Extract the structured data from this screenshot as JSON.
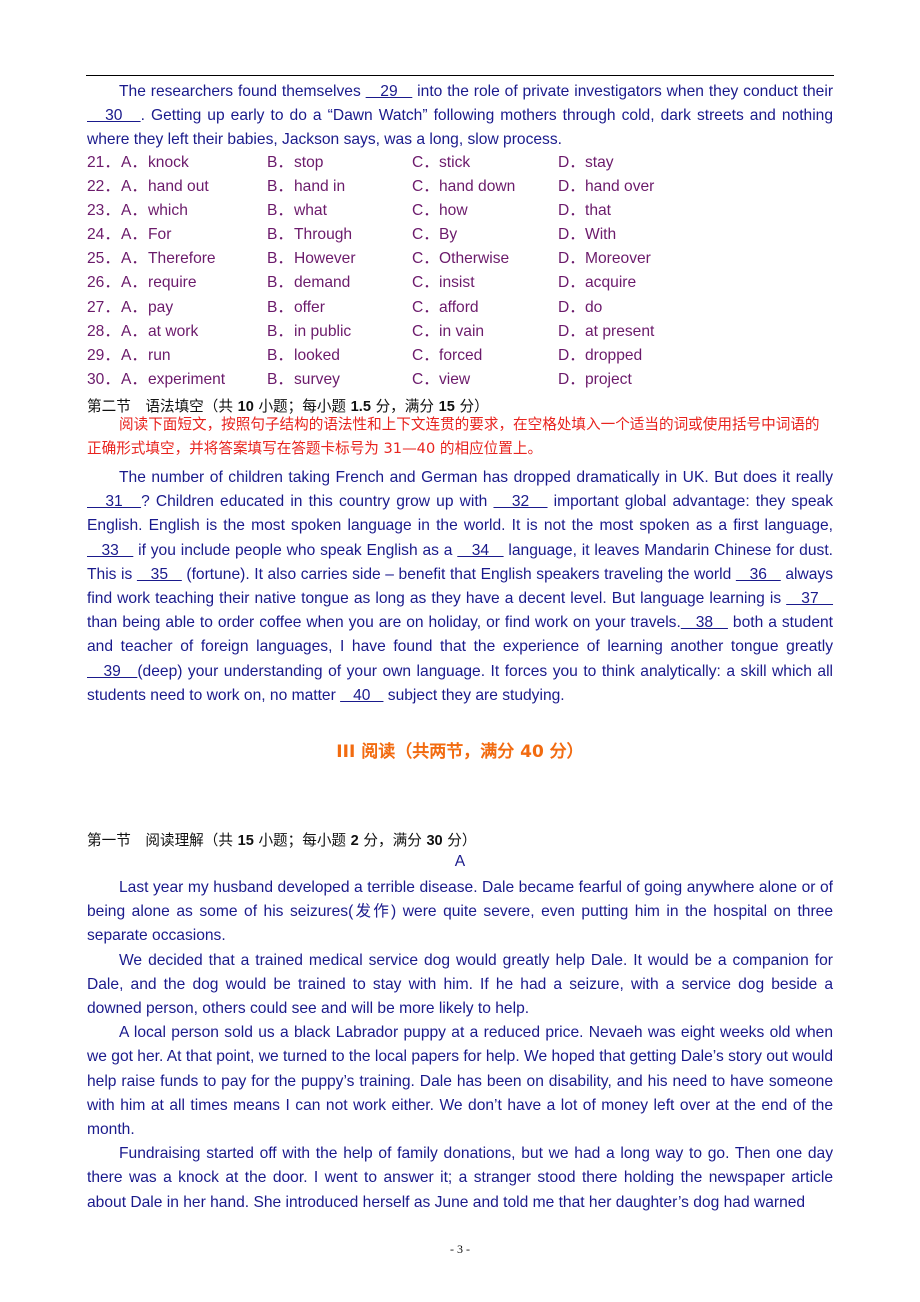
{
  "cloze_tail": {
    "line1_pre": "The researchers found themselves ",
    "blank29": "   29   ",
    "line1_post": " into the role of private investigators when they conduct their ",
    "blank30": "   30   ",
    "line2_post": ". Getting up early to do a “Dawn Watch” following mothers through cold, dark streets and nothing where they left their babies, Jackson says, was a long, slow process."
  },
  "options": [
    {
      "num": "21．",
      "A": "knock",
      "B": "stop",
      "C": "stick",
      "D": "stay"
    },
    {
      "num": "22．",
      "A": "hand out",
      "B": "hand in",
      "C": "hand down",
      "D": "hand over"
    },
    {
      "num": "23．",
      "A": "which",
      "B": "what",
      "C": "how",
      "D": "that"
    },
    {
      "num": "24．",
      "A": "For",
      "B": "Through",
      "C": "By",
      "D": "With"
    },
    {
      "num": "25．",
      "A": "Therefore",
      "B": "However",
      "C": "Otherwise",
      "D": "Moreover"
    },
    {
      "num": "26．",
      "A": "require",
      "B": "demand",
      "C": "insist",
      "D": "acquire"
    },
    {
      "num": "27．",
      "A": "pay",
      "B": "offer",
      "C": "afford",
      "D": "do"
    },
    {
      "num": "28．",
      "A": "at work",
      "B": "in public",
      "C": "in vain",
      "D": "at present"
    },
    {
      "num": "29．",
      "A": "run",
      "B": "looked",
      "C": "forced",
      "D": "dropped"
    },
    {
      "num": "30．",
      "A": "experiment",
      "B": "survey",
      "C": "view",
      "D": "project"
    }
  ],
  "option_labels": {
    "A": "A．",
    "B": "B．",
    "C": "C．",
    "D": "D．"
  },
  "section2": {
    "heading_prefix": "第二节　语法填空（共 ",
    "count": "10",
    "heading_mid1": " 小题；每小题 ",
    "per": "1.5",
    "heading_mid2": " 分，满分 ",
    "total": "15",
    "heading_suffix": " 分）",
    "instructions": "阅读下面短文，按照句子结构的语法性和上下文连贯的要求，在空格处填入一个适当的词或使用括号中词语的正确形式填空，并将答案填写在答题卡标号为 31—40 的相应位置上。"
  },
  "grammar_passage": {
    "s1": "The number of children taking French and German has dropped dramatically in UK. But does it really ",
    "b31": "   31   ",
    "s2": "? Children educated in this country grow up with ",
    "b32": "   32   ",
    "s3": " important global advantage: they speak English. English is the most spoken language in the world. It is not the most spoken as a first language,",
    "b33": "   33   ",
    "s4": " if you include people who speak English as a ",
    "b34": "   34   ",
    "s5": " language, it leaves Mandarin Chinese for dust. This is ",
    "b35": "   35   ",
    "s6": " (fortune). It also carries side – benefit that English speakers traveling the world ",
    "b36": "   36   ",
    "s7": " always find work teaching their native tongue as long as they have a decent level. But language learning is ",
    "b37": "   37   ",
    "s8": " than being able to order coffee when you are on holiday, or find work on your travels.",
    "b38": "   38   ",
    "s9": " both a student and teacher of foreign languages, I have found that the experience of learning another tongue greatly",
    "b39": "   39   ",
    "s10": "(deep) your understanding of your own language. It forces you to think analytically: a skill which all students need to work on, no matter ",
    "b40": "   40   ",
    "s11": " subject they are studying."
  },
  "part3_title": "III  阅读（共两节，满分 40 分）",
  "section1": {
    "heading_prefix": "第一节　阅读理解（共 ",
    "count": "15",
    "heading_mid1": " 小题；每小题 ",
    "per": "2",
    "heading_mid2": " 分，满分 ",
    "total": "30",
    "heading_suffix": " 分）"
  },
  "passage_a": {
    "letter": "A",
    "p1": "Last year my husband developed a terrible disease. Dale became fearful of going anywhere alone or of being alone as some of his seizures(发作) were quite severe, even putting him in the hospital on three separate occasions.",
    "p2": "We decided that a trained medical service dog would greatly help Dale. It would be a companion for Dale, and the dog would be trained to stay with him. If he had a seizure, with a service dog beside a downed person, others could see and will be more likely to help.",
    "p3": "A local person sold us a black Labrador puppy at a reduced price. Nevaeh was eight weeks old when we got her. At that point, we turned to the local papers for help. We hoped that getting Dale’s story out would help raise funds to pay for the puppy’s training. Dale has been on disability, and his need to have someone with him at all times means I can not work either. We don’t have a lot of money left over at the end of the month.",
    "p4": "Fundraising started off with the help of family donations, but we had a long way to go. Then one day there was a knock at the door. I went to answer it;  a stranger stood there holding the newspaper article about Dale in her hand. She introduced herself as June and told me that her daughter’s dog had warned"
  },
  "page_number": "- 3 -"
}
